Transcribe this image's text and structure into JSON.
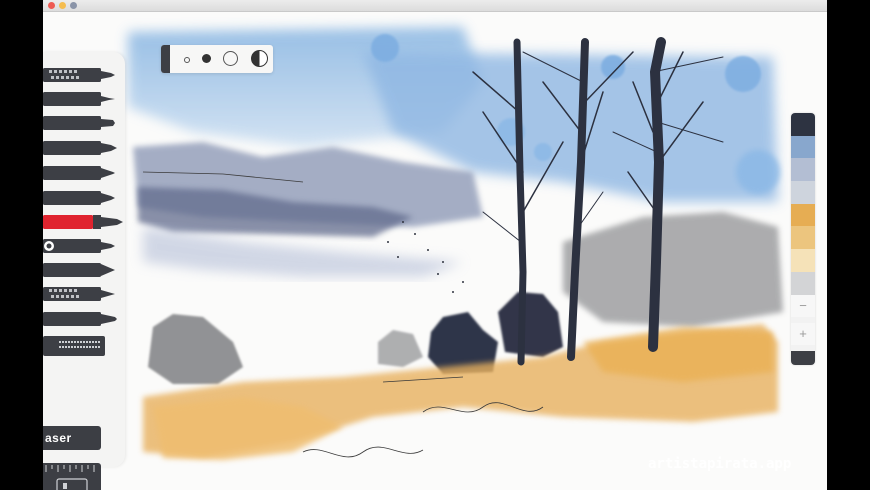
{
  "window": {
    "traffic_lights": [
      "#ee5b53",
      "#f5bd4f",
      "#8a94a8"
    ]
  },
  "tools": {
    "items": [
      {
        "name": "stipple-brush"
      },
      {
        "name": "technical-pen"
      },
      {
        "name": "marker"
      },
      {
        "name": "fountain-marker"
      },
      {
        "name": "pencil"
      },
      {
        "name": "crayon"
      },
      {
        "name": "watercolor-brush",
        "selected": true,
        "accent": "#e0242f"
      },
      {
        "name": "eyedropper-pen"
      },
      {
        "name": "charcoal"
      },
      {
        "name": "textured-brush"
      },
      {
        "name": "calligraphy-nib"
      },
      {
        "name": "pattern-roller"
      }
    ],
    "eraser_label": "aser"
  },
  "brush_size": {
    "options": [
      "tiny",
      "small",
      "medium",
      "large"
    ],
    "selected": "small"
  },
  "palette": {
    "colors": [
      "#2d3341",
      "#88a7cd",
      "#b3bed3",
      "#ced4dd",
      "#e6ad53",
      "#ecc57e",
      "#f5e2b8",
      "#d3d4d6"
    ],
    "minus_label": "−",
    "plus_label": "+"
  },
  "watermark": "artistapirata.app"
}
